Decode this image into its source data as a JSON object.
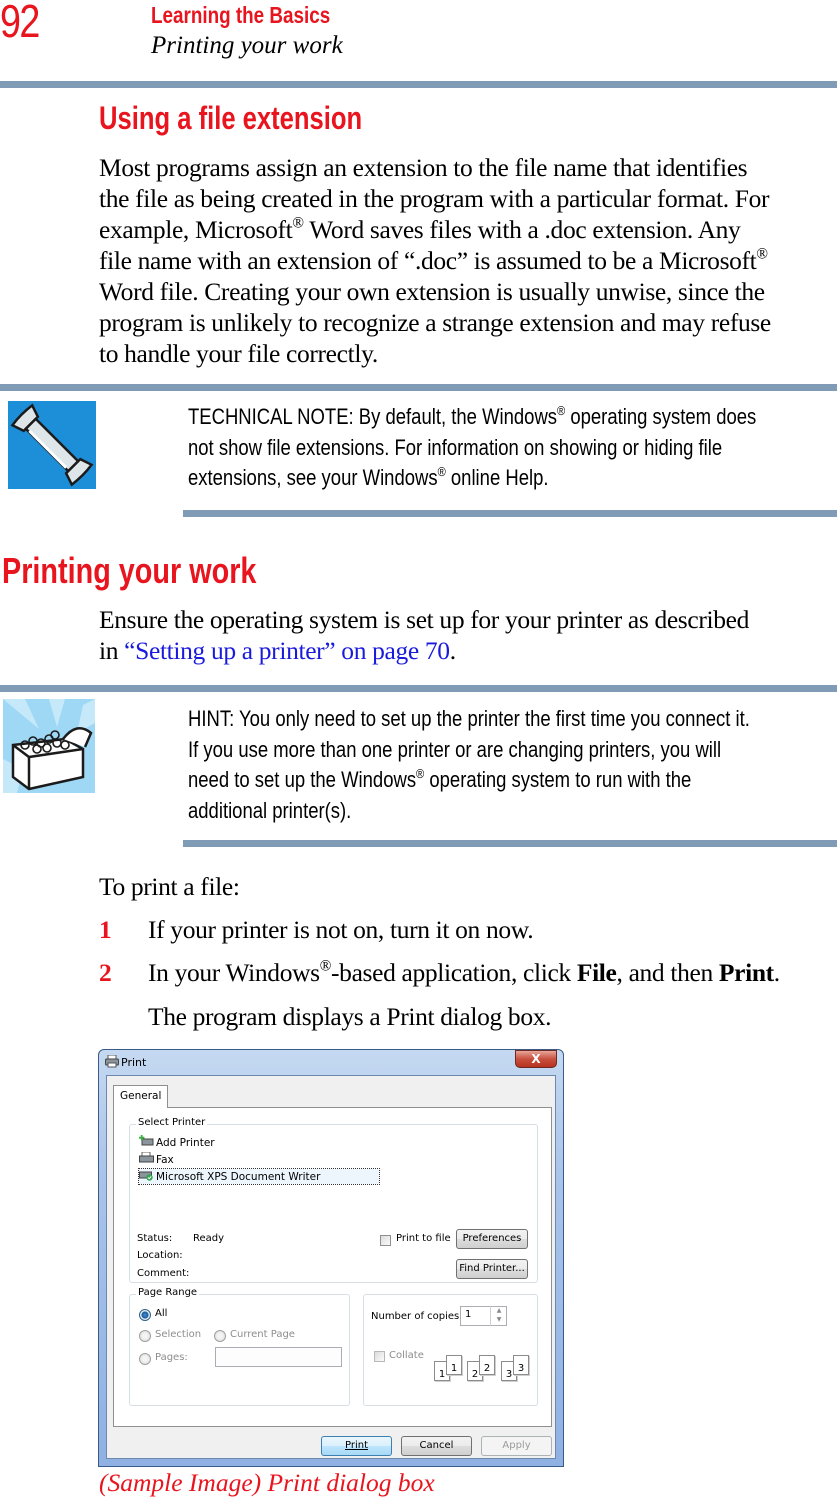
{
  "header": {
    "page_number": "92",
    "chapter_title": "Learning the Basics",
    "section_title": "Printing your work"
  },
  "section_file_extension": {
    "heading": "Using a file extension",
    "paragraph_lines": [
      "Most programs assign an extension to the file name that identifies",
      "the file as being created in the program with a particular format. For"
    ],
    "line3_a": "example, Microsoft",
    "line3_b": " Word saves files with a .doc extension. Any",
    "line4_a": "file name with an extension of “.doc” is assumed to be a Microsoft",
    "paragraph_tail": [
      "Word file. Creating your own extension is usually unwise, since the",
      "program is unlikely to recognize a strange extension and may refuse",
      "to handle your file correctly."
    ],
    "registered": "®"
  },
  "technical_note": {
    "icon": "wrench-icon",
    "line1_a": "TECHNICAL NOTE: By default, the Windows",
    "line1_b": " operating system does",
    "line2": "not show file extensions. For information on showing or hiding file",
    "line3_a": "extensions, see your Windows",
    "line3_b": " online Help."
  },
  "section_printing": {
    "heading": "Printing your work",
    "intro_line1": "Ensure the operating system is set up for your printer as described",
    "intro_prefix": "in ",
    "intro_link": "“Setting up a printer” on page 70",
    "intro_suffix": "."
  },
  "hint": {
    "icon": "treasure-chest-icon",
    "line1": "HINT: You only need to set up the printer the first time you connect it.",
    "line2": "If you use more than one printer or are changing printers, you will",
    "line3_a": "need to set up the Windows",
    "line3_b": " operating system to run with the",
    "line4": "additional printer(s)."
  },
  "procedure": {
    "intro": "To print a file:",
    "steps": [
      {
        "number": "1",
        "text": "If your printer is not on, turn it on now."
      },
      {
        "number": "2",
        "text_a": "In your Windows",
        "text_b": "-based application, click ",
        "bold1": "File",
        "text_c": ", and then ",
        "bold2": "Print",
        "text_d": "."
      }
    ],
    "result": "The program displays a Print dialog box."
  },
  "dialog": {
    "title": "Print",
    "close_glyph": "X",
    "tab": "General",
    "select_printer_label": "Select Printer",
    "printers": [
      {
        "name": "Add Printer",
        "icon": "add-printer-icon"
      },
      {
        "name": "Fax",
        "icon": "fax-icon"
      },
      {
        "name": "Microsoft XPS Document Writer",
        "icon": "default-printer-icon",
        "selected": true
      }
    ],
    "status_label": "Status:",
    "status_value": "Ready",
    "location_label": "Location:",
    "comment_label": "Comment:",
    "print_to_file": "Print to file",
    "print_to_file_checked": false,
    "preferences_button": "Preferences",
    "find_printer_button": "Find Printer...",
    "page_range_label": "Page Range",
    "range_all": "All",
    "range_selection": "Selection",
    "range_current_page": "Current Page",
    "range_pages": "Pages:",
    "range_pages_value": "",
    "selected_range": "All",
    "copies_label": "Number of copies:",
    "copies_value": "1",
    "collate_label": "Collate",
    "collate_checked": false,
    "collate_pages": [
      "1",
      "1",
      "2",
      "2",
      "3",
      "3"
    ],
    "print_button": "Print",
    "cancel_button": "Cancel",
    "apply_button": "Apply"
  },
  "caption": "(Sample Image) Print dialog box"
}
